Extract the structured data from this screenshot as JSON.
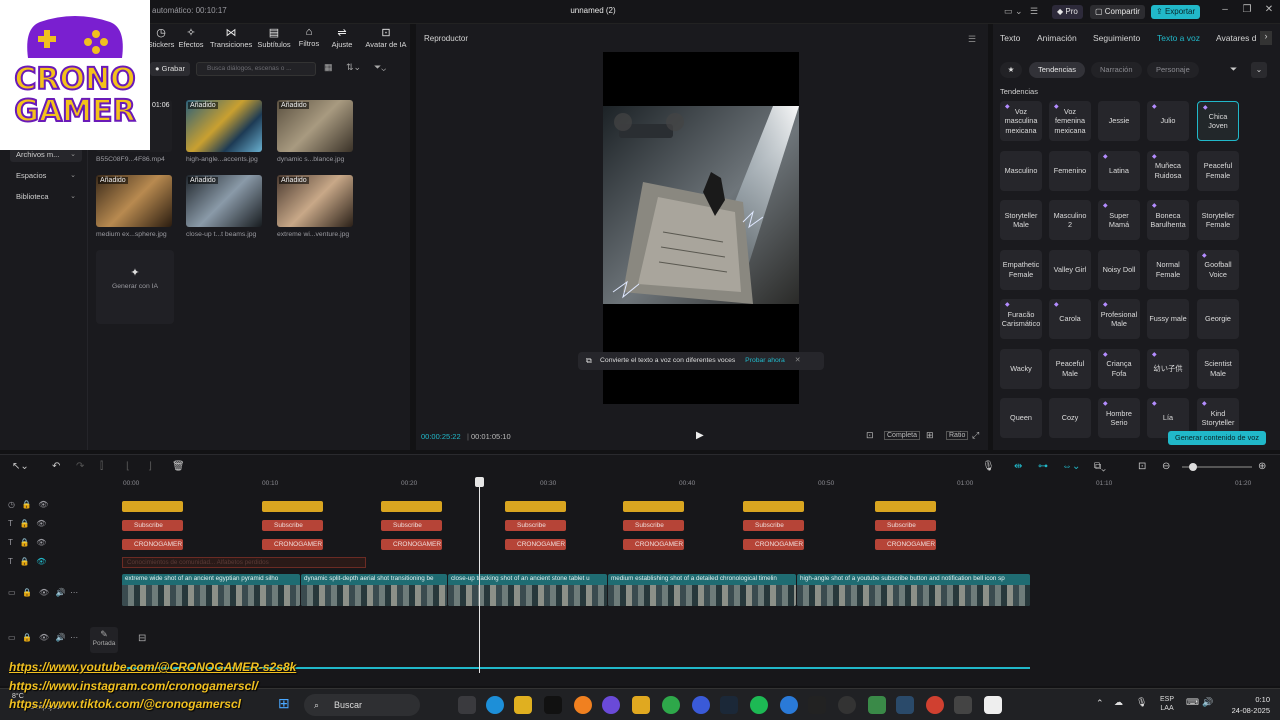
{
  "logo": {
    "line1": "CRONO",
    "line2": "GAMER"
  },
  "titlebar": {
    "autosave": "automático: 00:10:17",
    "doc_title": "unnamed (2)",
    "pro": "Pro",
    "share": "Compartir",
    "export": "Exportar"
  },
  "toolbar": {
    "items": [
      {
        "label": "Stickers"
      },
      {
        "label": "Efectos"
      },
      {
        "label": "Transiciones"
      },
      {
        "label": "Subtítulos"
      },
      {
        "label": "Filtros"
      },
      {
        "label": "Ajuste"
      },
      {
        "label": "Avatar de IA"
      }
    ]
  },
  "media": {
    "record_label": "Grabar",
    "search_placeholder": "Busca diálogos, escenas o ...",
    "duration_badge": "01:06",
    "added_badge": "Añadido",
    "items": [
      {
        "name": "B55C08F9...4F86.mp4"
      },
      {
        "name": "high-angle...accents.jpg"
      },
      {
        "name": "dynamic s...blance.jpg"
      },
      {
        "name": "medium ex...sphere.jpg"
      },
      {
        "name": "close-up t...t beams.jpg"
      },
      {
        "name": "extreme wi...venture.jpg"
      }
    ],
    "generate_ia": "Generar con IA"
  },
  "sidebar": {
    "items": [
      {
        "label": "Archivos m..."
      },
      {
        "label": "Espacios"
      },
      {
        "label": "Biblioteca"
      }
    ]
  },
  "player": {
    "title": "Reproductor",
    "toast_text": "Convierte el texto a voz con diferentes voces",
    "toast_action": "Probar ahora",
    "time_current": "00:00:25:22",
    "time_total": "00:01:05:10",
    "quality": "Completa",
    "ratio": "Ratio"
  },
  "right_panel": {
    "tabs": [
      "Texto",
      "Animación",
      "Seguimiento",
      "Texto a voz",
      "Avatares d"
    ],
    "active_tab": 3,
    "filters": [
      "Tendencias",
      "Narración",
      "Personaje"
    ],
    "section_title": "Tendencias",
    "voices": [
      "Voz masculina mexicana",
      "Voz femenina mexicana",
      "Jessie",
      "Julio",
      "Chica Joven",
      "Masculino",
      "Femenino",
      "Latina",
      "Muñeca Ruidosa",
      "Peaceful Female",
      "Storyteller Male",
      "Masculino 2",
      "Super Mamá",
      "Boneca Barulhenta",
      "Storyteller Female",
      "Empathetic Female",
      "Valley Girl",
      "Noisy Doll",
      "Normal Female",
      "Goofball Voice",
      "Furacão Carismático",
      "Carola",
      "Profesional Male",
      "Fussy male",
      "Georgie",
      "Wacky",
      "Peaceful Male",
      "Criança Fofa",
      "幼い子供",
      "Scientist Male",
      "Queen",
      "Cozy",
      "Hombre Serio",
      "Lía",
      "Kind Storyteller"
    ],
    "generate_button": "Generar contenido de voz"
  },
  "timeline": {
    "ruler": [
      "00:00",
      "00:10",
      "00:20",
      "00:30",
      "00:40",
      "00:50",
      "01:00",
      "01:10",
      "01:20"
    ],
    "subscribe_label": "Subscribe",
    "crono_label": "CRONOGAMER",
    "cover_label": "Portada",
    "video_clips": [
      "extreme wide shot of an ancient egyptian pyramid silho",
      "dynamic split-depth aerial shot transitioning be",
      "close-up tracking shot of an ancient stone tablet u",
      "medium establishing shot of a detailed chronological timelin",
      "high-angle shot of a youtube subscribe button and notification bell icon sp"
    ],
    "text_clip": "Conocimientos de comunidad... Alfabetos perdidos"
  },
  "taskbar": {
    "search": "Buscar",
    "weather": "8°C",
    "weather_desc": "Despejado",
    "lang": "ESP",
    "lang2": "LAA",
    "time": "0:10",
    "date": "24-08-2025"
  },
  "social": {
    "youtube": "https://www.youtube.com/@CRONOGAMER-s2s8k",
    "instagram": "https://www.instagram.com/cronogamerscl/",
    "tiktok": "https://www.tiktok.com/@cronogamerscl"
  }
}
